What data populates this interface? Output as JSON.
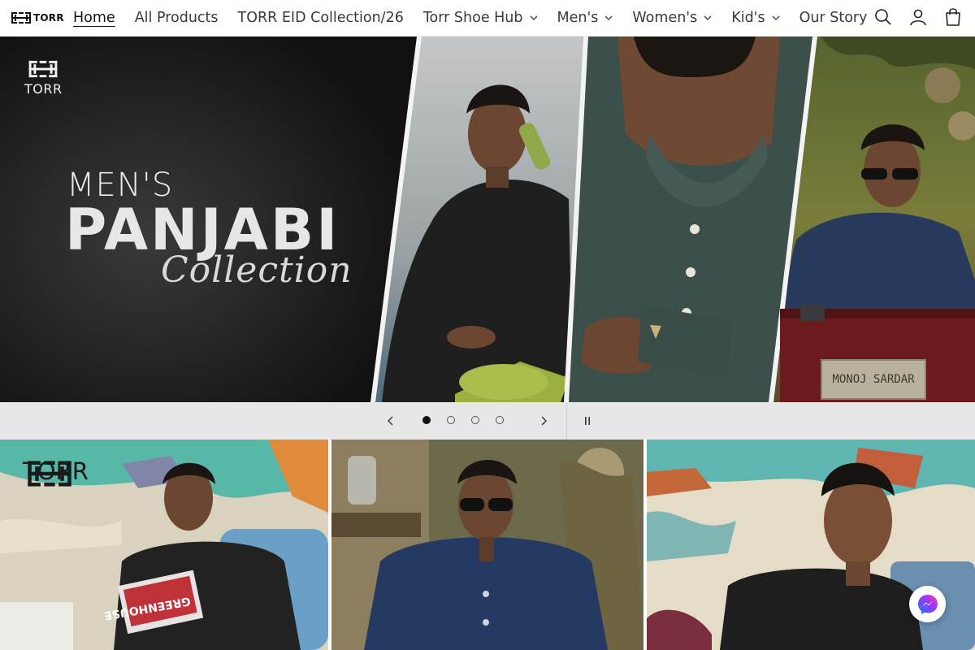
{
  "header": {
    "logo_text": "TORR",
    "nav": [
      {
        "label": "Home",
        "active": true,
        "dropdown": false
      },
      {
        "label": "All Products",
        "active": false,
        "dropdown": false
      },
      {
        "label": "TORR EID Collection/26",
        "active": false,
        "dropdown": false
      },
      {
        "label": "Torr Shoe Hub",
        "active": false,
        "dropdown": true
      },
      {
        "label": "Men's",
        "active": false,
        "dropdown": true
      },
      {
        "label": "Women's",
        "active": false,
        "dropdown": true
      },
      {
        "label": "Kid's",
        "active": false,
        "dropdown": true
      },
      {
        "label": "Our Story",
        "active": false,
        "dropdown": false
      }
    ],
    "icons": [
      "search-icon",
      "account-icon",
      "cart-icon"
    ]
  },
  "hero": {
    "logo_text": "TORR",
    "line1": "MEN'S",
    "line2": "PANJABI",
    "line3": "Collection",
    "plaque_text": "MONOJ SARDAR"
  },
  "slideshow": {
    "slide_count": 4,
    "active_slide": 1,
    "prev_icon": "chevron-left-icon",
    "next_icon": "chevron-right-icon",
    "pause_icon": "pause-icon"
  },
  "tiles": {
    "first_logo_text": "TORR",
    "magazine_text": "GREENHOUSE"
  },
  "colors": {
    "accent": "#121212",
    "nav_text": "#3a3a3a",
    "control_bar": "#e7e7e7",
    "hero_dark": "#1b1b1b",
    "messenger_gradient_start": "#0a7cff",
    "messenger_gradient_end": "#ff4f7b"
  },
  "messenger": {
    "icon": "messenger-icon"
  }
}
